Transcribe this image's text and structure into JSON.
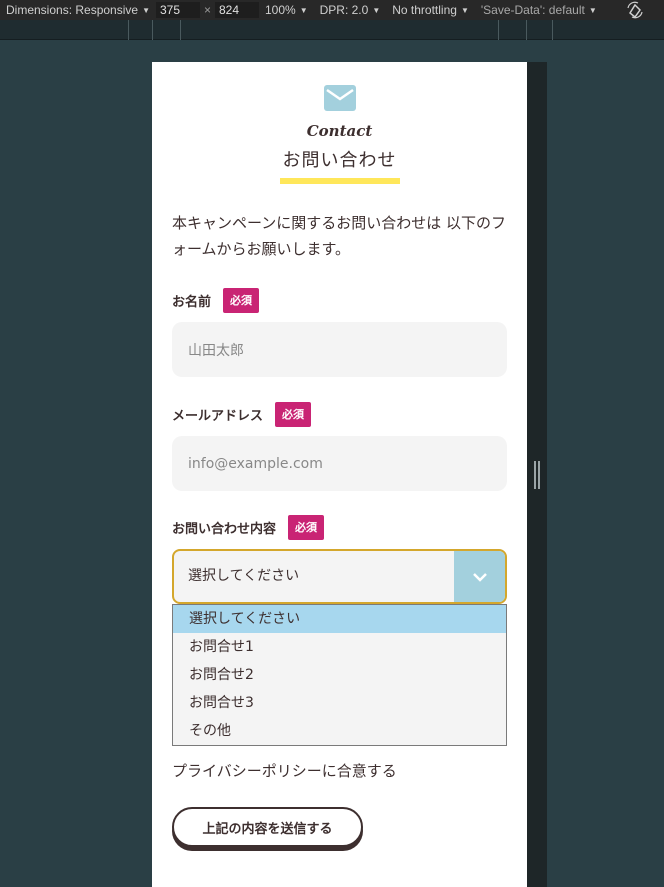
{
  "devtools": {
    "dimensions_label": "Dimensions: Responsive",
    "width": "375",
    "times": "×",
    "height": "824",
    "zoom": "100%",
    "dpr": "DPR: 2.0",
    "throttling": "No throttling",
    "save_data": "'Save-Data': default"
  },
  "header": {
    "title_en": "Contact",
    "title_jp": "お問い合わせ"
  },
  "intro": "本キャンペーンに関するお問い合わせは 以下のフォームからお願いします。",
  "form": {
    "required_badge": "必須",
    "name": {
      "label": "お名前",
      "placeholder": "山田太郎"
    },
    "email": {
      "label": "メールアドレス",
      "placeholder": "info@example.com"
    },
    "inquiry": {
      "label": "お問い合わせ内容",
      "selected": "選択してください",
      "options": [
        "選択してください",
        "お問合せ1",
        "お問合せ2",
        "お問合せ3",
        "その他"
      ]
    },
    "privacy": "プライバシーポリシーに合意する",
    "submit_label": "上記の内容を送信する"
  },
  "colors": {
    "accent_yellow": "#ffe75a",
    "badge_magenta": "#c92474",
    "icon_blue": "#a3d0dd",
    "text_brown": "#3d2f2f",
    "focus_gold": "#d4a72c"
  }
}
